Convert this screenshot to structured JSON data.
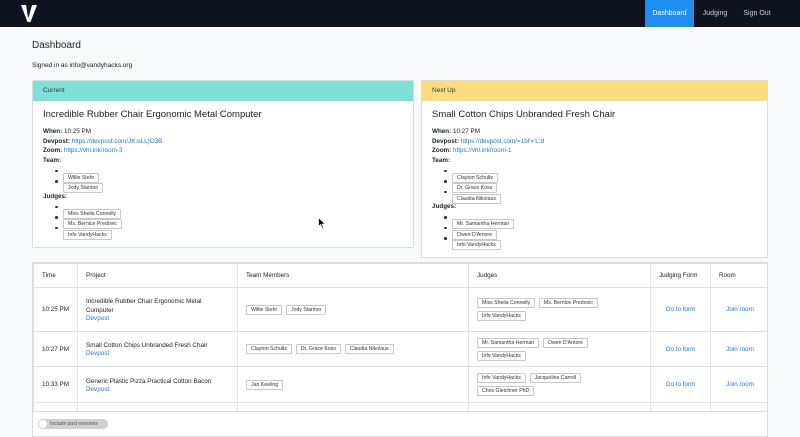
{
  "nav": {
    "logo_icon": "vandyhacks-v-logo",
    "items": [
      {
        "label": "Dashboard",
        "active": true
      },
      {
        "label": "Judging",
        "active": false
      },
      {
        "label": "Sign Out",
        "active": false
      }
    ]
  },
  "page": {
    "title": "Dashboard",
    "signed_in": "Signed in as info@vandyhacks.org"
  },
  "current": {
    "header": "Current",
    "header_color": "#7fe0d8",
    "title": "Incredible Rubber Chair Ergonomic Metal Computer",
    "when_label": "When:",
    "when": "10:25 PM",
    "devpost_label": "Devpost:",
    "devpost": "https://devpost.com/JK.oLL)O3B",
    "zoom_label": "Zoom:",
    "zoom": "https://vhl.ink/room-3",
    "team_label": "Team:",
    "team": [
      "Willie Stehr",
      "Jody Stanton"
    ],
    "judges_label": "Judges:",
    "judges": [
      "Miss Sheila Connelly",
      "Ms. Bernice Predovic",
      "Info VandyHacks"
    ]
  },
  "next_up": {
    "header": "Next Up",
    "header_color": "#fcdc80",
    "title": "Small Cotton Chips Unbranded Fresh Chair",
    "when_label": "When:",
    "when": "10:27 PM",
    "devpost_label": "Devpost:",
    "devpost": "https://devpost.com/=1bl'='L:d",
    "zoom_label": "Zoom:",
    "zoom": "https://vhl.ink/room-1",
    "team_label": "Team:",
    "team": [
      "Clayton Schultz",
      "Dr. Grace Koss",
      "Claudia Nikolaus"
    ],
    "judges_label": "Judges:",
    "judges": [
      "Mr. Samantha Herman",
      "Owen D'Amore",
      "Info VandyHacks"
    ]
  },
  "table": {
    "headers": [
      "Time",
      "Project",
      "Team Members",
      "Judges",
      "Judging Form",
      "Room"
    ],
    "rows": [
      {
        "time": "10:25 PM",
        "project": "Incredible Rubber Chair Ergonomic Metal Computer",
        "devpost": "Devpost",
        "team": [
          "Willie Stehr",
          "Jody Stanton"
        ],
        "judges": [
          "Miss Sheila Connelly",
          "Ms. Bernice Predovic",
          "Info VandyHacks"
        ],
        "form": "Go to form",
        "room": "Join room"
      },
      {
        "time": "10:27 PM",
        "project": "Small Cotton Chips Unbranded Fresh Chair",
        "devpost": "Devpost",
        "team": [
          "Clayton Schultz",
          "Dr. Grace Koss",
          "Claudia Nikolaus"
        ],
        "judges": [
          "Mr. Samantha Herman",
          "Owen D'Amore",
          "Info VandyHacks"
        ],
        "form": "Go to form",
        "room": "Join room"
      },
      {
        "time": "10:33 PM",
        "project": "Generic Plastic Pizza Practical Cotton Bacon",
        "devpost": "Devpost",
        "team": [
          "Jan Keeling"
        ],
        "judges": [
          "Info VandyHacks",
          "Jacqueline Carroll",
          "Chris Gleichner PhD"
        ],
        "form": "Go to form",
        "room": "Join room"
      }
    ]
  },
  "toggle": {
    "label": "Include past sessions",
    "on": false
  }
}
